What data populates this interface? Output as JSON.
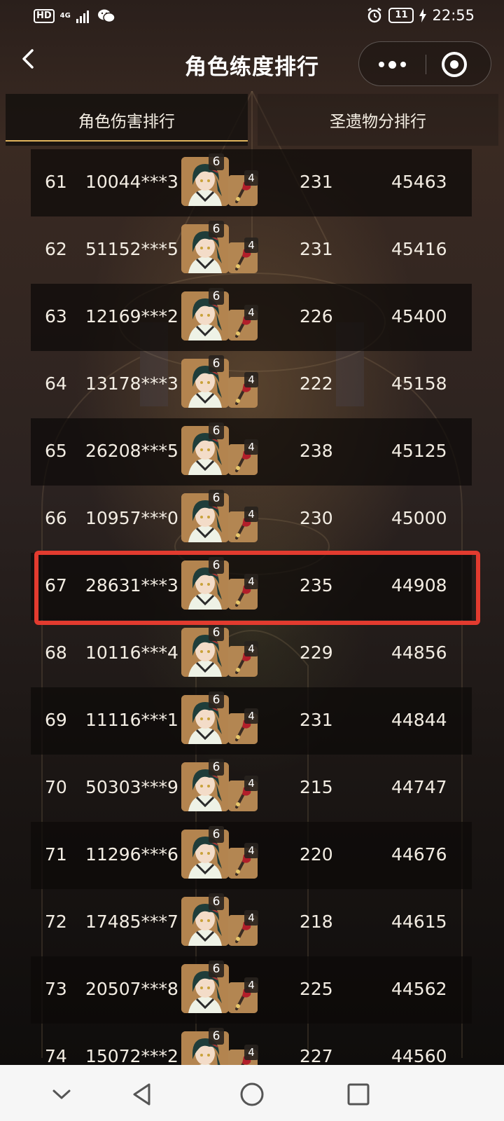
{
  "status_bar": {
    "hd": "HD",
    "network": "4G",
    "battery": "11",
    "time": "22:55"
  },
  "header": {
    "title": "角色练度排行"
  },
  "tabs": [
    {
      "label": "角色伤害排行",
      "active": true
    },
    {
      "label": "圣遗物分排行",
      "active": false
    }
  ],
  "rows": [
    {
      "rank": "61",
      "uid": "10044***3",
      "constellation": "6",
      "refinement": "4",
      "atk": "231",
      "damage": "45463"
    },
    {
      "rank": "62",
      "uid": "51152***5",
      "constellation": "6",
      "refinement": "4",
      "atk": "231",
      "damage": "45416"
    },
    {
      "rank": "63",
      "uid": "12169***2",
      "constellation": "6",
      "refinement": "4",
      "atk": "226",
      "damage": "45400"
    },
    {
      "rank": "64",
      "uid": "13178***3",
      "constellation": "6",
      "refinement": "4",
      "atk": "222",
      "damage": "45158"
    },
    {
      "rank": "65",
      "uid": "26208***5",
      "constellation": "6",
      "refinement": "4",
      "atk": "238",
      "damage": "45125"
    },
    {
      "rank": "66",
      "uid": "10957***0",
      "constellation": "6",
      "refinement": "4",
      "atk": "230",
      "damage": "45000"
    },
    {
      "rank": "67",
      "uid": "28631***3",
      "constellation": "6",
      "refinement": "4",
      "atk": "235",
      "damage": "44908"
    },
    {
      "rank": "68",
      "uid": "10116***4",
      "constellation": "6",
      "refinement": "4",
      "atk": "229",
      "damage": "44856"
    },
    {
      "rank": "69",
      "uid": "11116***1",
      "constellation": "6",
      "refinement": "4",
      "atk": "231",
      "damage": "44844"
    },
    {
      "rank": "70",
      "uid": "50303***9",
      "constellation": "6",
      "refinement": "4",
      "atk": "215",
      "damage": "44747"
    },
    {
      "rank": "71",
      "uid": "11296***6",
      "constellation": "6",
      "refinement": "4",
      "atk": "220",
      "damage": "44676"
    },
    {
      "rank": "72",
      "uid": "17485***7",
      "constellation": "6",
      "refinement": "4",
      "atk": "218",
      "damage": "44615"
    },
    {
      "rank": "73",
      "uid": "20507***8",
      "constellation": "6",
      "refinement": "4",
      "atk": "225",
      "damage": "44562"
    },
    {
      "rank": "74",
      "uid": "15072***2",
      "constellation": "6",
      "refinement": "4",
      "atk": "227",
      "damage": "44560"
    }
  ],
  "highlighted_rank": "67",
  "colors": {
    "accent": "#e0b45c",
    "highlight": "#e23b2f"
  },
  "icons": {
    "header": [
      "back-icon",
      "more-icon",
      "close-icon"
    ],
    "navigation": [
      "collapse-icon",
      "back-triangle-icon",
      "home-icon",
      "recents-icon"
    ]
  }
}
